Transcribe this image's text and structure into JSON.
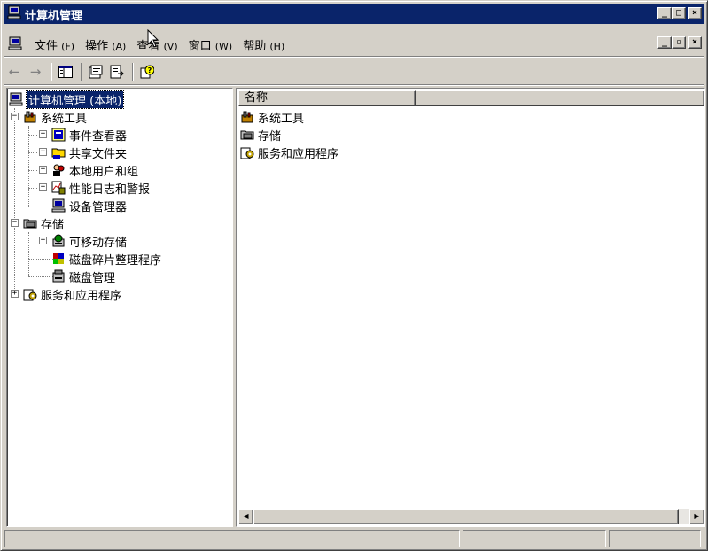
{
  "window": {
    "title": "计算机管理"
  },
  "menu": [
    {
      "label": "文件",
      "accel": "(F)"
    },
    {
      "label": "操作",
      "accel": "(A)"
    },
    {
      "label": "查看",
      "accel": "(V)"
    },
    {
      "label": "窗口",
      "accel": "(W)"
    },
    {
      "label": "帮助",
      "accel": "(H)"
    }
  ],
  "caption_buttons": {
    "minimize": "_",
    "maximize": "□",
    "close": "×"
  },
  "mdi_buttons": {
    "minimize": "_",
    "restore": "▫",
    "close": "×"
  },
  "toolbar": {
    "back_icon": "back-arrow-icon",
    "forward_icon": "forward-arrow-icon",
    "buttons": [
      "show-hide-tree-icon",
      "properties-icon",
      "export-list-icon",
      "help-icon"
    ]
  },
  "tree": {
    "root": "计算机管理 (本地)",
    "system_tools": "系统工具",
    "event_viewer": "事件查看器",
    "shared_folders": "共享文件夹",
    "local_users_groups": "本地用户和组",
    "perf_logs": "性能日志和警报",
    "device_manager": "设备管理器",
    "storage": "存储",
    "removable_storage": "可移动存储",
    "disk_defrag": "磁盘碎片整理程序",
    "disk_management": "磁盘管理",
    "services_apps": "服务和应用程序"
  },
  "list": {
    "column_name": "名称",
    "items": [
      "系统工具",
      "存储",
      "服务和应用程序"
    ]
  },
  "expander": {
    "collapsed": "+",
    "expanded": "−"
  },
  "colors": {
    "title_bar": "#0a246a",
    "face": "#d4d0c8",
    "desktop": "#3a6ea5"
  }
}
